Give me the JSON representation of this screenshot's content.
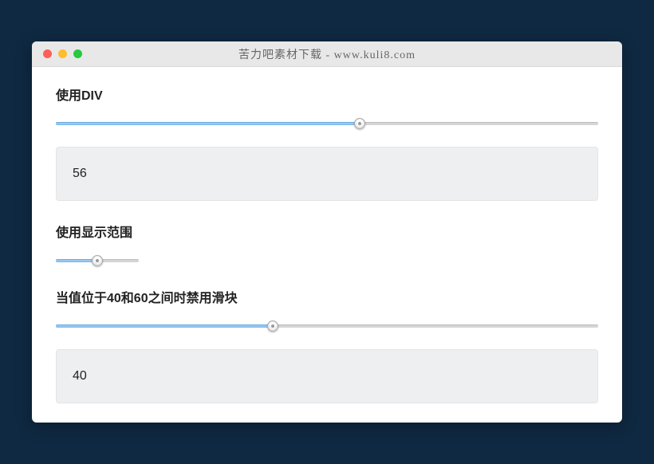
{
  "window": {
    "title": "苦力吧素材下载 - www.kuli8.com"
  },
  "section1": {
    "title": "使用DIV",
    "slider": {
      "percent": 56
    },
    "value": "56"
  },
  "section2": {
    "title": "使用显示范围",
    "slider": {
      "percent": 50
    }
  },
  "section3": {
    "title": "当值位于40和60之间时禁用滑块",
    "slider": {
      "percent": 40
    },
    "value": "40"
  }
}
